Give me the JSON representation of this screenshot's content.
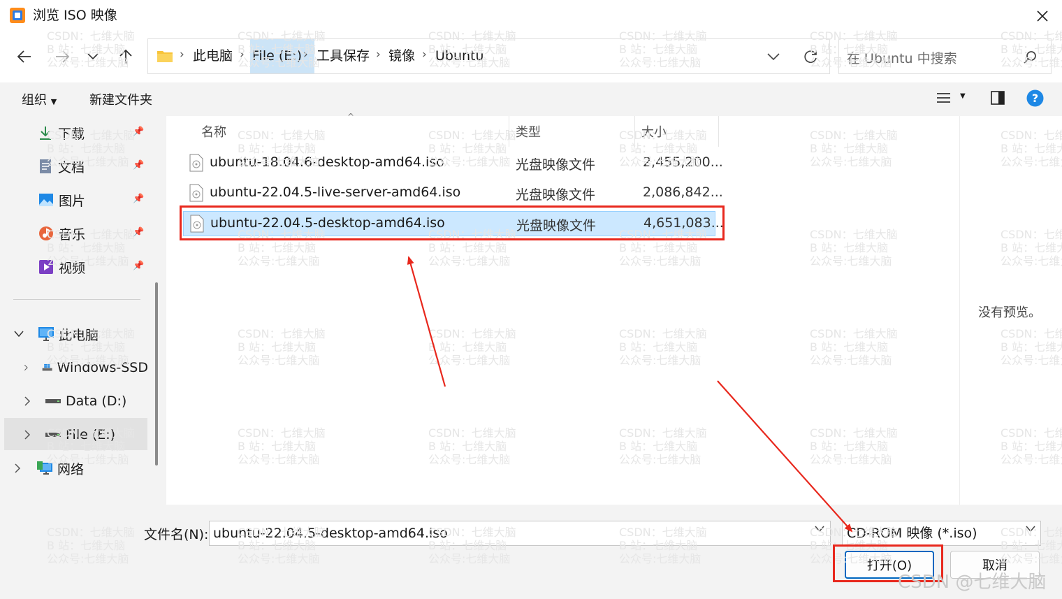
{
  "window": {
    "title": "浏览 ISO 映像"
  },
  "nav": {
    "breadcrumb": [
      "此电脑",
      "File (E:)",
      "工具保存",
      "镜像",
      "Ubuntu"
    ],
    "search_placeholder": "在 Ubuntu 中搜索"
  },
  "toolbar": {
    "organize_label": "组织",
    "new_folder_label": "新建文件夹"
  },
  "sidebar": {
    "quick_access": [
      {
        "label": "下载",
        "icon": "download-icon"
      },
      {
        "label": "文档",
        "icon": "document-icon"
      },
      {
        "label": "图片",
        "icon": "pictures-icon"
      },
      {
        "label": "音乐",
        "icon": "music-icon"
      },
      {
        "label": "视频",
        "icon": "video-icon"
      }
    ],
    "this_pc": "此电脑",
    "drives": [
      "Windows-SSD",
      "Data (D:)",
      "File (E:)"
    ],
    "network": "网络"
  },
  "columns": {
    "name": "名称",
    "type": "类型",
    "size": "大小"
  },
  "files": [
    {
      "name": "ubuntu-18.04.6-desktop-amd64.iso",
      "type": "光盘映像文件",
      "size": "2,455,200..."
    },
    {
      "name": "ubuntu-22.04.5-live-server-amd64.iso",
      "type": "光盘映像文件",
      "size": "2,086,842..."
    },
    {
      "name": "ubuntu-22.04.5-desktop-amd64.iso",
      "type": "光盘映像文件",
      "size": "4,651,083..."
    }
  ],
  "selected_file_index": 2,
  "preview": {
    "text": "没有预览。"
  },
  "footer": {
    "filename_label": "文件名(N):",
    "filename_value": "ubuntu-22.04.5-desktop-amd64.iso",
    "filter_value": "CD-ROM 映像 (*.iso)",
    "open_label": "打开(O)",
    "cancel_label": "取消"
  },
  "watermark": {
    "corner": "CSDN @七维大脑",
    "tile_lines": [
      "CSDN：七维大脑",
      "B 站：七维大脑",
      "公众号:七维大脑"
    ]
  },
  "colors": {
    "accent": "#0067c0",
    "selection": "#cce8ff",
    "annotation_red": "#e8281d"
  }
}
